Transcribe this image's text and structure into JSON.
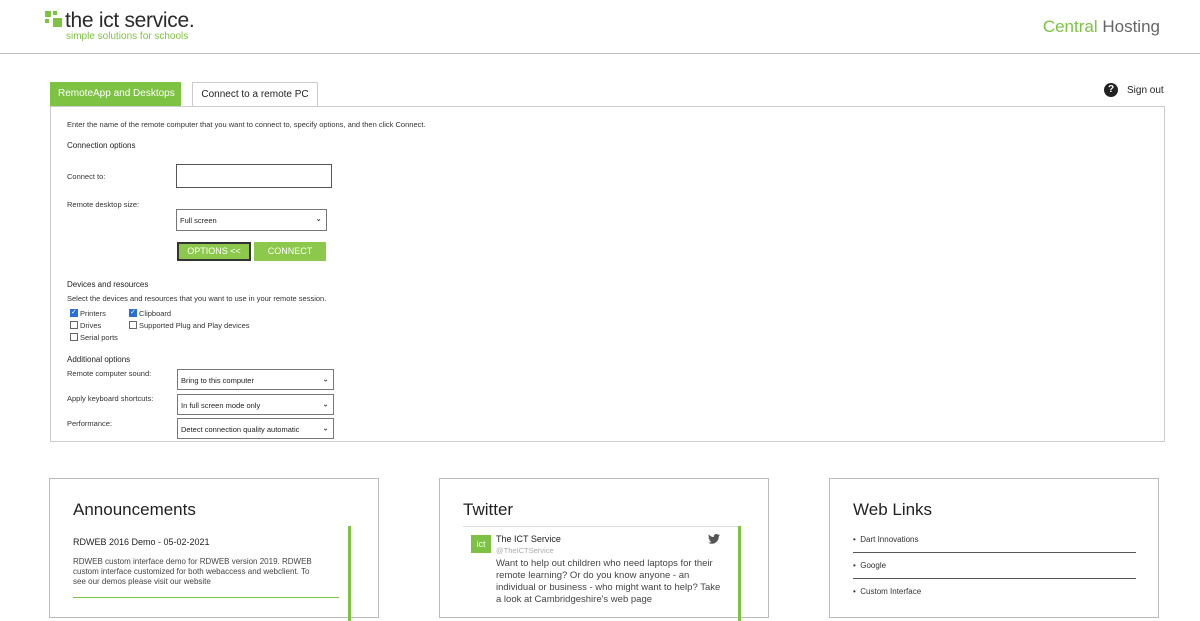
{
  "brand": {
    "logo_main": "the ict service.",
    "logo_sub": "simple solutions for schools",
    "hosting_part1": "Central",
    "hosting_part2": " Hosting",
    "accent": "#7dc242"
  },
  "tabs": [
    {
      "label": "RemoteApp and Desktops"
    },
    {
      "label": "Connect to a remote PC"
    }
  ],
  "topbar": {
    "help_icon": "question-circle-icon",
    "signout": "Sign out"
  },
  "form": {
    "intro": "Enter the name of the remote computer that you want to connect to, specify options, and then click Connect.",
    "connection_options": "Connection options",
    "connect_to_label": "Connect to:",
    "connect_to_value": "",
    "remote_size_label": "Remote desktop size:",
    "remote_size_value": "Full screen",
    "options_button": "OPTIONS <<",
    "connect_button": "CONNECT",
    "devices_heading": "Devices and resources",
    "devices_desc": "Select the devices and resources that you want to use in your remote session.",
    "checkboxes": [
      {
        "label": "Printers",
        "checked": true
      },
      {
        "label": "Clipboard",
        "checked": true
      },
      {
        "label": "Drives",
        "checked": false
      },
      {
        "label": "Supported Plug and Play devices",
        "checked": false
      },
      {
        "label": "Serial ports",
        "checked": false
      }
    ],
    "additional_heading": "Additional options",
    "sound_label": "Remote computer sound:",
    "sound_value": "Bring to this computer",
    "keyboard_label": "Apply keyboard shortcuts:",
    "keyboard_value": "In full screen mode only",
    "performance_label": "Performance:",
    "performance_value": "Detect connection quality automatic"
  },
  "announcements": {
    "title": "Announcements",
    "item_title": "RDWEB 2016 Demo - 05-02-2021",
    "item_body": "RDWEB custom interface demo for RDWEB version 2019. RDWEB custom interface customized for both webaccess and webclient. To see our demos please visit our website"
  },
  "twitter": {
    "title": "Twitter",
    "logo_text": "ict",
    "name": "The ICT Service",
    "handle": "@TheICTService",
    "bird_icon": "twitter-bird-icon",
    "tweet": "Want to help out children who need laptops for their remote learning? Or do you know anyone - an individual or business - who might want to help? Take a look at Cambridgeshire's web page"
  },
  "weblinks": {
    "title": "Web Links",
    "items": [
      "Dart Innovations",
      "Google",
      "Custom Interface"
    ]
  }
}
